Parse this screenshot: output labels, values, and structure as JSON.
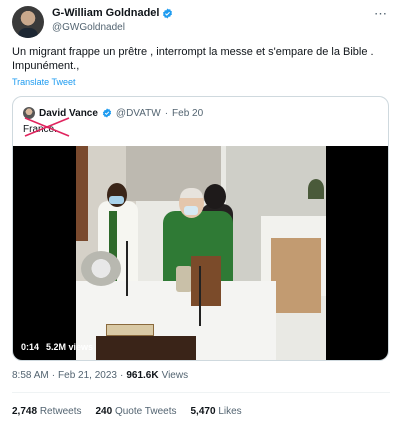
{
  "tweet": {
    "author_name": "G-William Goldnadel",
    "author_handle": "@GWGoldnadel",
    "more_icon": "more-icon",
    "text": "Un migrant frappe un prêtre , interrompt la messe et s'empare de la Bible . Impunément.,",
    "translate_label": "Translate Tweet",
    "time": "8:58 AM",
    "date": "Feb 21, 2023",
    "views_count": "961.6K",
    "views_label": "Views",
    "retweets_count": "2,748",
    "retweets_label": "Retweets",
    "quotes_count": "240",
    "quotes_label": "Quote Tweets",
    "likes_count": "5,470",
    "likes_label": "Likes"
  },
  "quoted": {
    "author_name": "David Vance",
    "author_handle": "@DVATW",
    "date": "Feb 20",
    "text": "France.",
    "video_time": "0:14",
    "video_views": "5.2M views"
  },
  "colors": {
    "accent": "#1d9bf0",
    "verified": "#1d9bf0",
    "strike": "#e0245e"
  }
}
